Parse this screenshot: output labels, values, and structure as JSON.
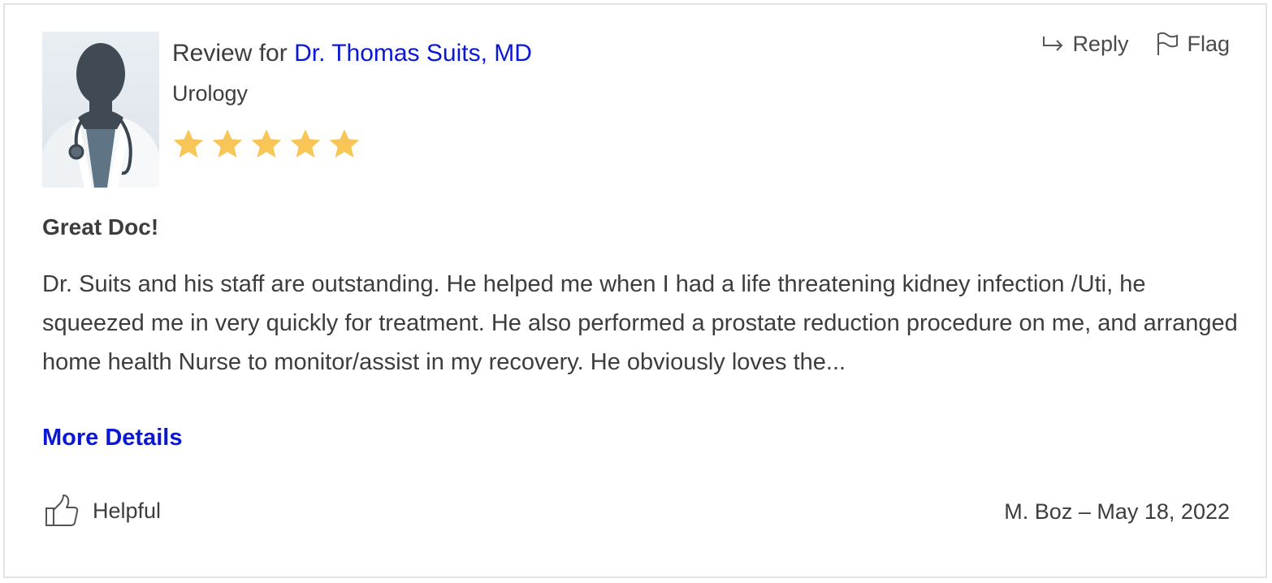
{
  "review": {
    "prefix": "Review for",
    "doctor_name": "Dr. Thomas Suits, MD",
    "specialty": "Urology",
    "rating": 5,
    "rating_max": 5,
    "title": "Great Doc!",
    "body": "Dr. Suits and his staff are outstanding. He helped me when I had a life threatening kidney infection /Uti, he squeezed me in very quickly for treatment. He also performed a prostate reduction procedure on me, and arranged home health Nurse to monitor/assist in my recovery. He obviously loves the...",
    "more_label": "More Details",
    "author": "M. Boz",
    "separator": "–",
    "date": "May 18, 2022"
  },
  "actions": {
    "reply_label": "Reply",
    "flag_label": "Flag",
    "helpful_label": "Helpful"
  },
  "icons": {
    "reply": "reply-arrow-icon",
    "flag": "flag-icon",
    "helpful": "thumbs-up-icon",
    "star": "star-icon"
  },
  "colors": {
    "link": "#0a17d4",
    "star": "#f7c656",
    "text": "#3d3d3d",
    "border": "#e2e2e2"
  }
}
